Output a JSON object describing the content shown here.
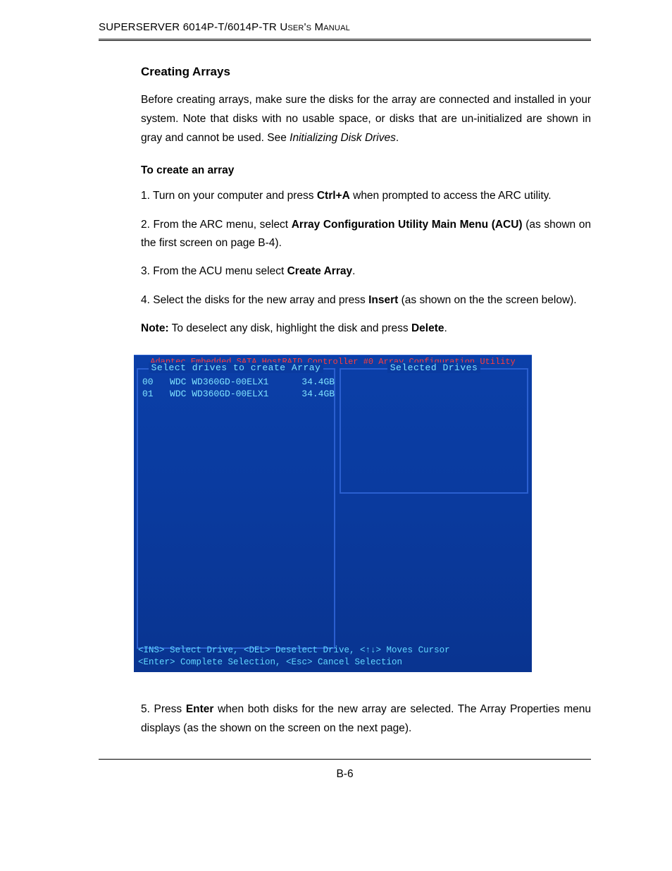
{
  "header": {
    "product_prefix": "S",
    "product_mid": "UPER",
    "product_prefix2": "S",
    "product_rest": "ERVER 6014P-T/6014P-TR User's Manual"
  },
  "section": {
    "title": "Creating Arrays",
    "intro_a": "Before creating arrays, make sure the disks for the array are connected and installed in your system.  Note that disks with no usable space, or disks that are un-initialized are shown in gray and cannot be used.  See ",
    "intro_italic": "Initializing Disk Drives",
    "intro_b": "."
  },
  "procedure": {
    "heading": "To create an array",
    "step1_a": "1. Turn on your computer and press ",
    "step1_bold": "Ctrl+A",
    "step1_b": " when prompted to access the ARC utility.",
    "step2_a": "2. From the ARC menu, select ",
    "step2_bold": "Array Configuration Utility Main Menu (ACU)",
    "step2_b": " (as shown on the first screen on page B-4).",
    "step3_a": "3. From the ACU menu select ",
    "step3_bold": "Create Array",
    "step3_b": ".",
    "step4_a": "4. Select the disks for the new array and press ",
    "step4_bold": "Insert",
    "step4_b": " (as shown on the the screen below).",
    "note_label": "Note:",
    "note_a": " To deselect any disk, highlight the disk and press ",
    "note_bold": "Delete",
    "note_b": ".",
    "step5_a": "5. Press ",
    "step5_bold": "Enter",
    "step5_b": " when both disks for the new array are selected.  The Array Properties menu displays (as the shown on the screen on the next page)."
  },
  "screenshot": {
    "titlebar": "Adaptec Embedded SATA HostRAID Controller #0 Array Configuration Utility",
    "left_title": "Select drives to create Array",
    "right_title": "Selected Drives",
    "drives": [
      {
        "id": "00",
        "model": "WDC WD360GD-00ELX1",
        "size": "34.4GB"
      },
      {
        "id": "01",
        "model": "WDC WD360GD-00ELX1",
        "size": "34.4GB"
      }
    ],
    "footer_line1": "<INS> Select Drive, <DEL> Deselect Drive, <↑↓> Moves Cursor",
    "footer_line2": "<Enter> Complete Selection, <Esc> Cancel Selection"
  },
  "page_number": "B-6"
}
